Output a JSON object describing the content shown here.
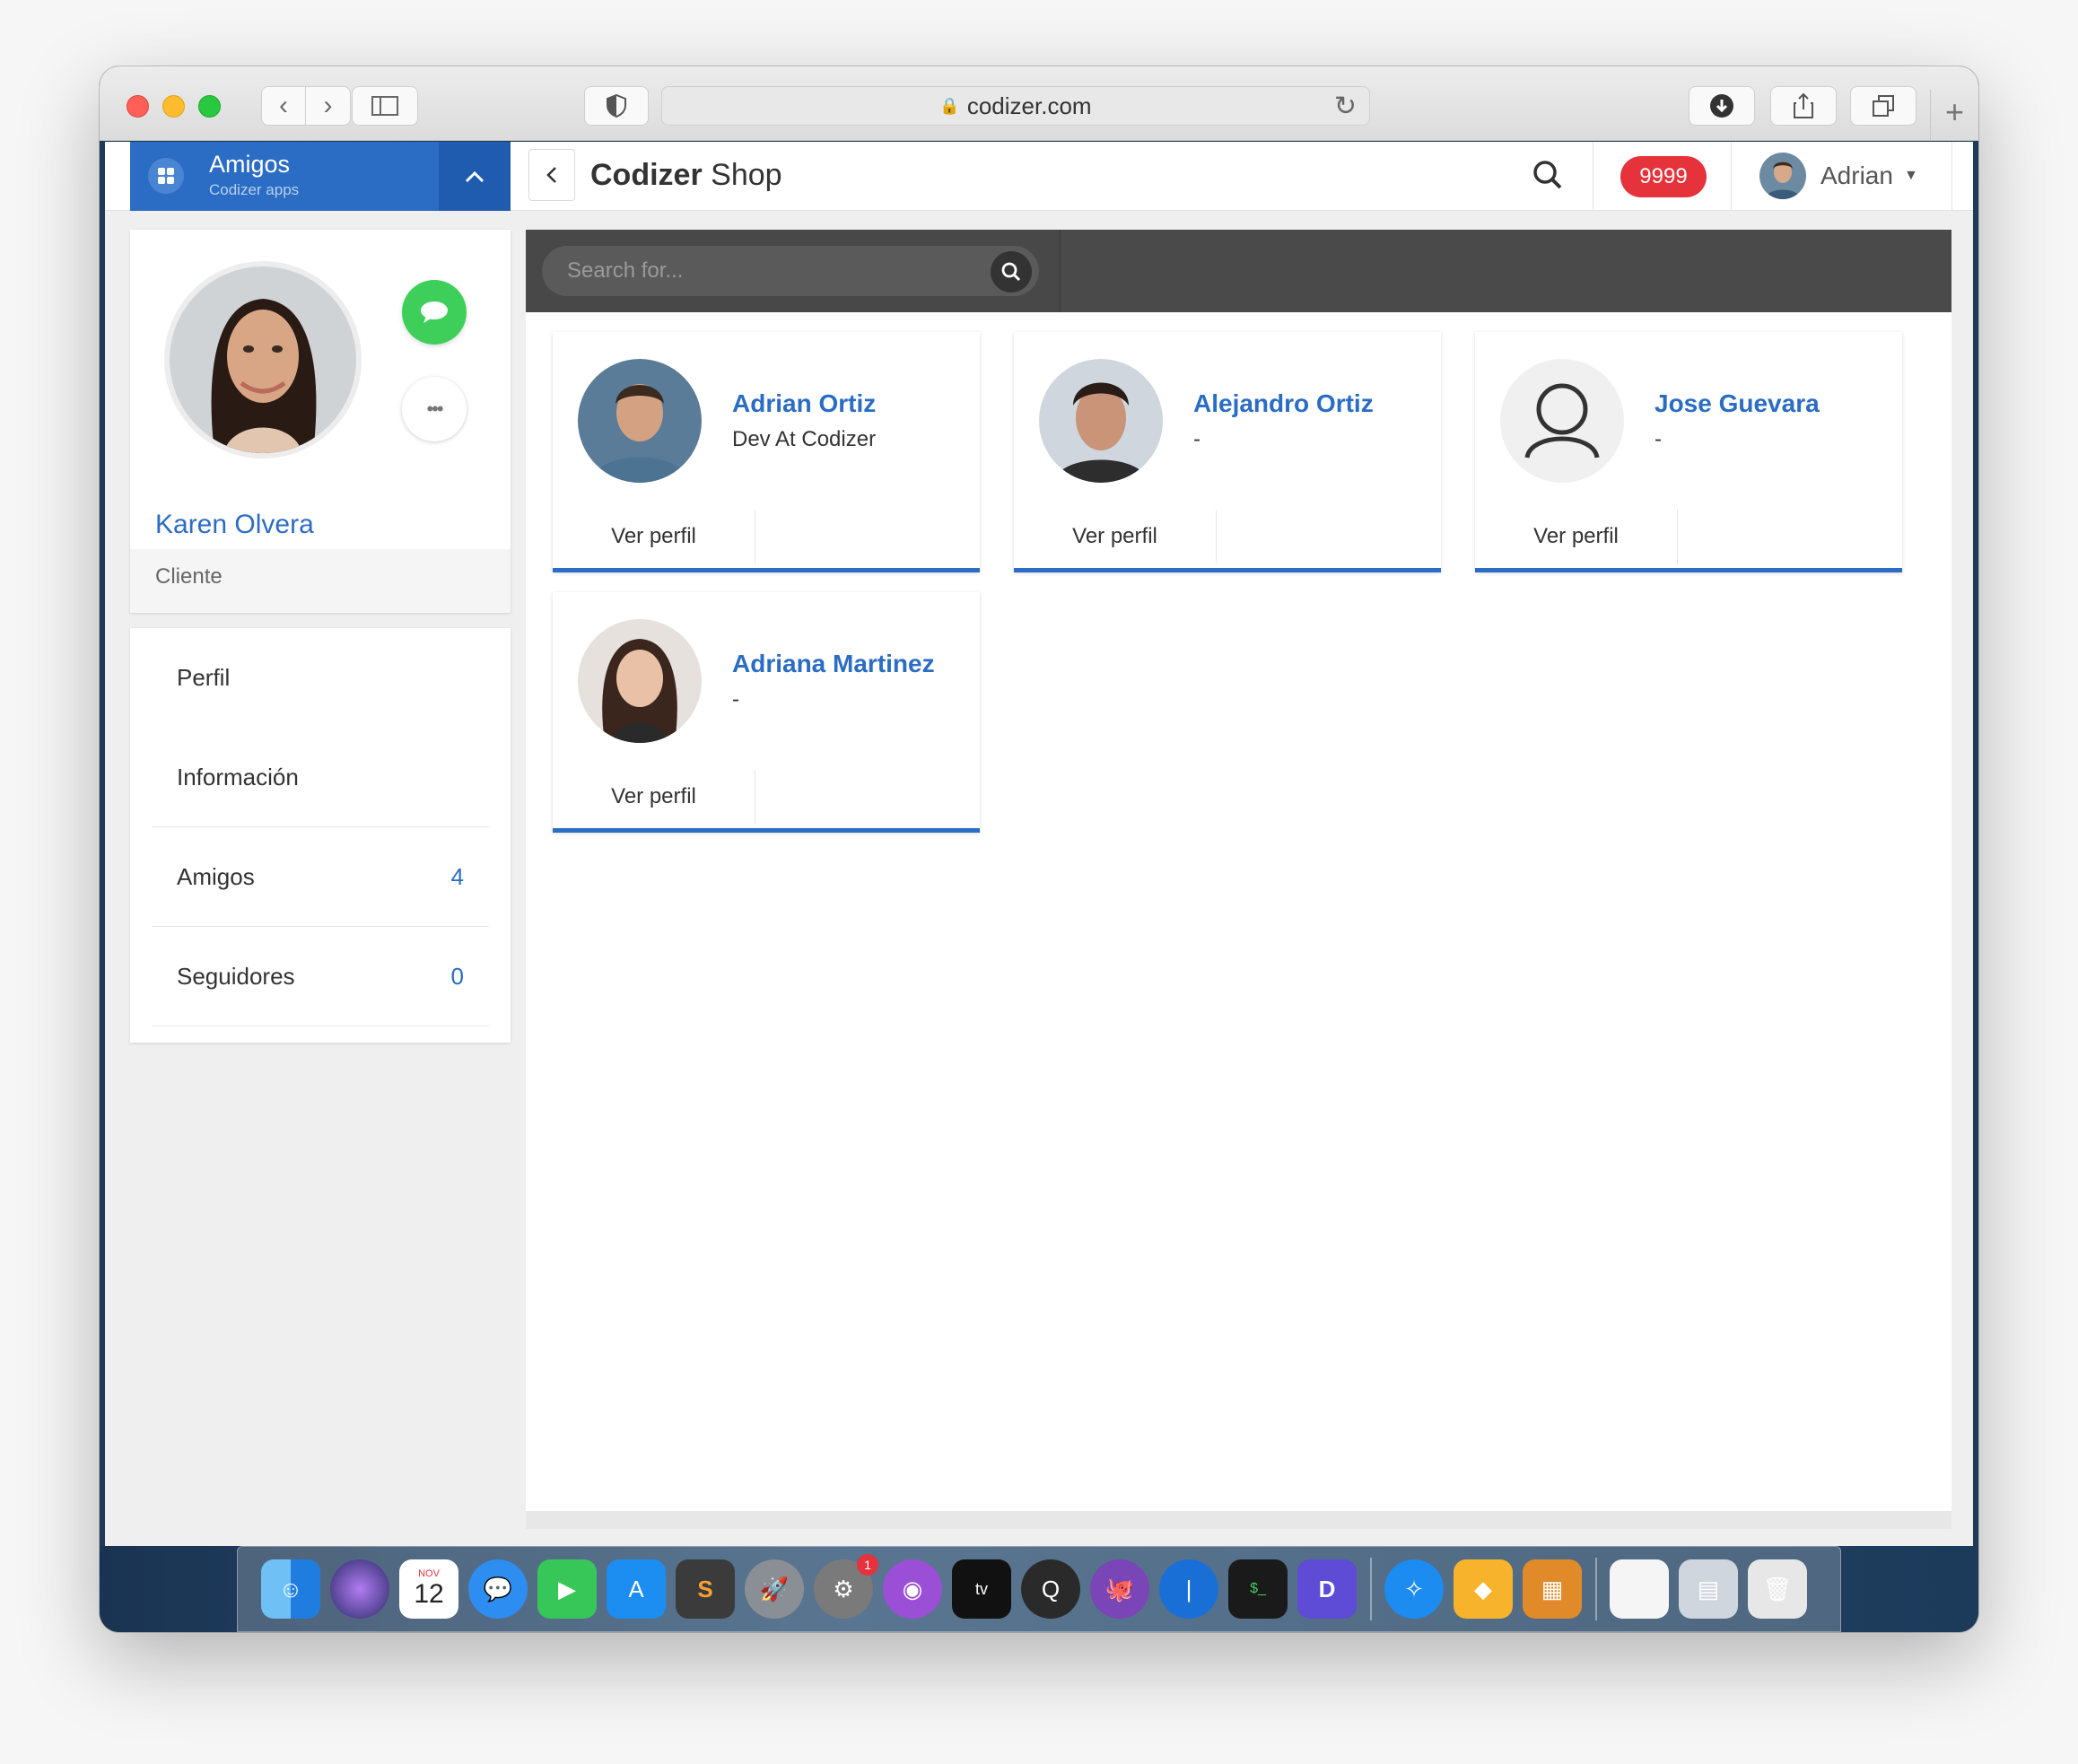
{
  "browser": {
    "url": "codizer.com"
  },
  "topbar": {
    "app_name": "Amigos",
    "app_sub": "Codizer apps",
    "title_bold": "Codizer",
    "title_rest": "Shop",
    "notifications": "9999",
    "user": "Adrian"
  },
  "profile": {
    "name": "Karen Olvera",
    "role": "Cliente"
  },
  "menu": {
    "items": [
      {
        "label": "Perfil",
        "count": ""
      },
      {
        "label": "Información",
        "count": ""
      },
      {
        "label": "Amigos",
        "count": "4"
      },
      {
        "label": "Seguidores",
        "count": "0"
      }
    ]
  },
  "search": {
    "placeholder": "Search for..."
  },
  "friends": [
    {
      "name": "Adrian Ortiz",
      "subtitle": "Dev At Codizer",
      "link": "Ver perfil"
    },
    {
      "name": "Alejandro Ortiz",
      "subtitle": "-",
      "link": "Ver perfil"
    },
    {
      "name": "Jose Guevara",
      "subtitle": "-",
      "link": "Ver perfil"
    },
    {
      "name": "Adriana Martinez",
      "subtitle": "-",
      "link": "Ver perfil"
    }
  ],
  "dock": {
    "calendar_month": "NOV",
    "calendar_day": "12",
    "settings_badge": "1",
    "tv_label": "tv"
  },
  "colors": {
    "accent": "#2b6cc4",
    "chat": "#3ecf5b",
    "badge": "#e5323b",
    "searchbar": "#4a4a4a"
  }
}
